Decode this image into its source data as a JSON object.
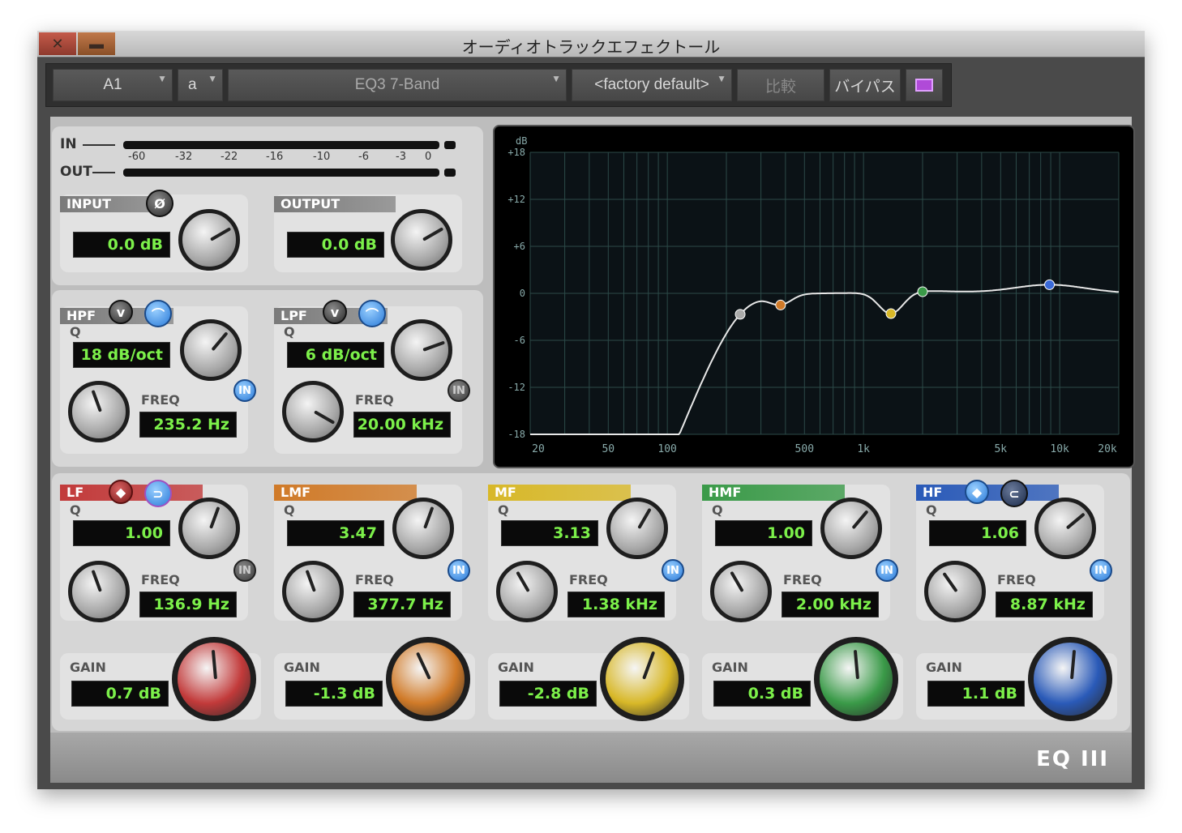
{
  "window": {
    "title": "オーディオトラックエフェクトール"
  },
  "toolbar": {
    "track": "A1",
    "slot": "a",
    "plugin": "EQ3 7-Band",
    "preset": "<factory default>",
    "compare": "比較",
    "bypass": "バイパス"
  },
  "meter": {
    "in_label": "IN",
    "out_label": "OUT",
    "scale": [
      "-60",
      "-32",
      "-22",
      "-16",
      "-10",
      "-6",
      "-3",
      "0"
    ]
  },
  "input": {
    "label": "INPUT",
    "phase": "Ø",
    "value": "0.0 dB"
  },
  "output": {
    "label": "OUTPUT",
    "value": "0.0 dB"
  },
  "hpf": {
    "label": "HPF",
    "q_label": "Q",
    "slope": "18 dB/oct",
    "freq_label": "FREQ",
    "freq": "235.2 Hz",
    "in": "IN"
  },
  "lpf": {
    "label": "LPF",
    "q_label": "Q",
    "slope": "6 dB/oct",
    "freq_label": "FREQ",
    "freq": "20.00 kHz",
    "in": "IN"
  },
  "bands": [
    {
      "label": "LF",
      "q_label": "Q",
      "q": "1.00",
      "freq_label": "FREQ",
      "freq": "136.9 Hz",
      "gain_label": "GAIN",
      "gain": "0.7 dB",
      "in": "IN",
      "color": "#c23a3a"
    },
    {
      "label": "LMF",
      "q_label": "Q",
      "q": "3.47",
      "freq_label": "FREQ",
      "freq": "377.7 Hz",
      "gain_label": "GAIN",
      "gain": "-1.3 dB",
      "in": "IN",
      "color": "#d07a28"
    },
    {
      "label": "MF",
      "q_label": "Q",
      "q": "3.13",
      "freq_label": "FREQ",
      "freq": "1.38 kHz",
      "gain_label": "GAIN",
      "gain": "-2.8 dB",
      "in": "IN",
      "color": "#d8b828"
    },
    {
      "label": "HMF",
      "q_label": "Q",
      "q": "1.00",
      "freq_label": "FREQ",
      "freq": "2.00 kHz",
      "gain_label": "GAIN",
      "gain": "0.3 dB",
      "in": "IN",
      "color": "#3a9a48"
    },
    {
      "label": "HF",
      "q_label": "Q",
      "q": "1.06",
      "freq_label": "FREQ",
      "freq": "8.87 kHz",
      "gain_label": "GAIN",
      "gain": "1.1 dB",
      "in": "IN",
      "color": "#2a5ab8"
    }
  ],
  "graph": {
    "unit": "dB",
    "y_ticks": [
      "+18",
      "+12",
      "+6",
      "0",
      "-6",
      "-12",
      "-18"
    ],
    "x_ticks": [
      "20",
      "50",
      "100",
      "500",
      "1k",
      "5k",
      "10k",
      "20k"
    ]
  },
  "logo": "EQ III"
}
